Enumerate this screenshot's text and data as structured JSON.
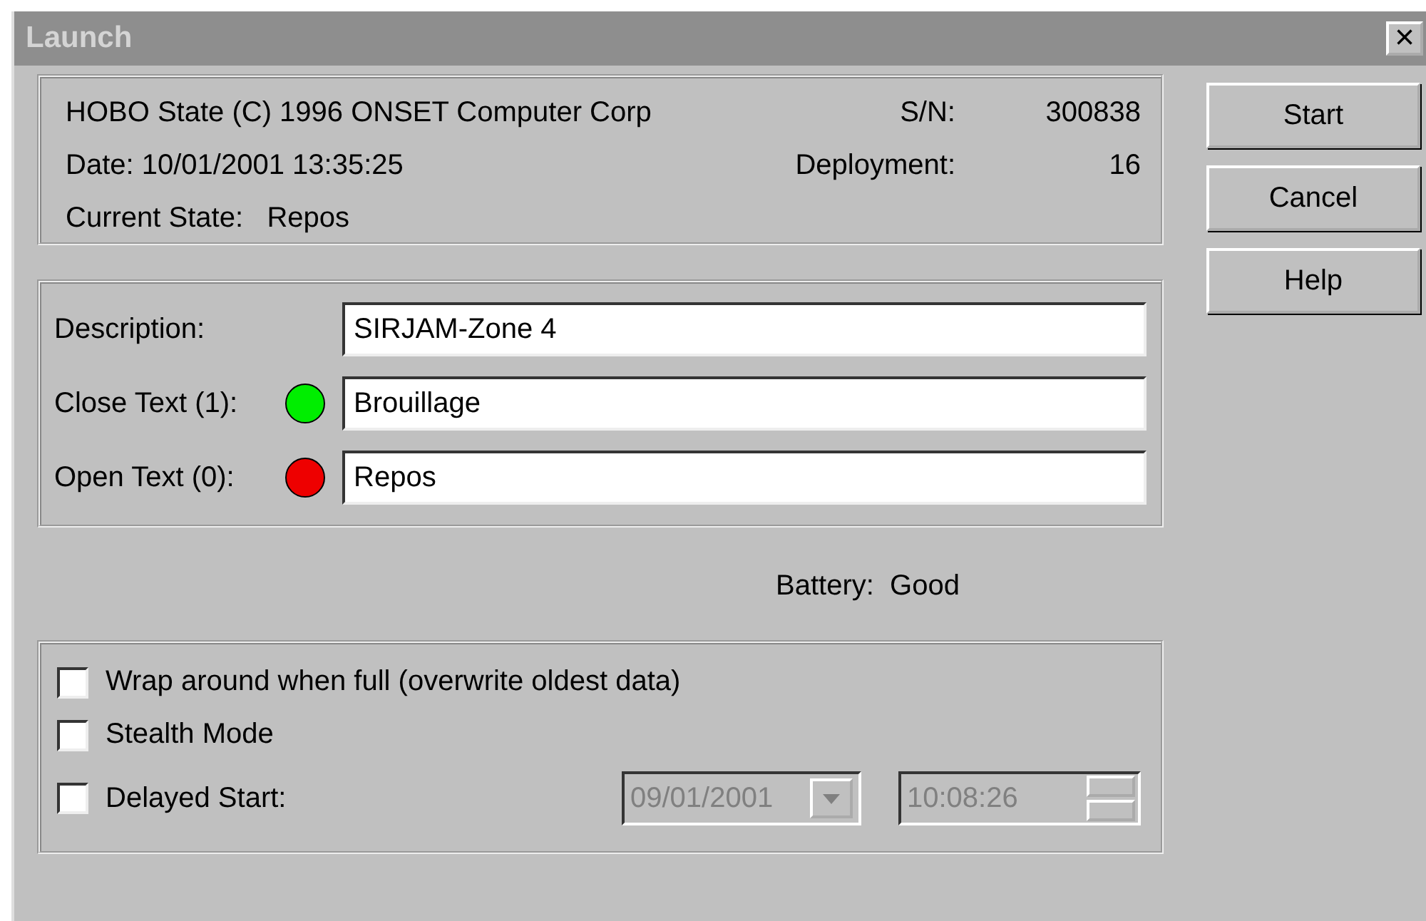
{
  "window": {
    "title": "Launch",
    "close": "×"
  },
  "info": {
    "header": "HOBO State (C) 1996 ONSET Computer Corp",
    "date_label": "Date:",
    "date_value": "10/01/2001  13:35:25",
    "state_label": "Current State:",
    "state_value": "Repos",
    "sn_label": "S/N:",
    "sn_value": "300838",
    "deployment_label": "Deployment:",
    "deployment_value": "16"
  },
  "fields": [
    {
      "label": "Description:",
      "value": "SIRJAM-Zone 4"
    },
    {
      "label": "Close Text (1):",
      "value": "Brouillage",
      "color": "#00ee00"
    },
    {
      "label": "Open Text (0):",
      "value": "Repos",
      "color": "#ee0000"
    }
  ],
  "battery": {
    "label": "Battery:",
    "value": "Good"
  },
  "options": [
    {
      "label": "Wrap around when full (overwrite oldest data)",
      "checked": false
    },
    {
      "label": "Stealth Mode",
      "checked": false
    },
    {
      "label": "Delayed Start:",
      "checked": false
    }
  ],
  "delayed_start": {
    "date": "09/01/2001",
    "time": "10:08:26",
    "disabled": true
  },
  "buttons": [
    "Start",
    "Cancel",
    "Help"
  ]
}
